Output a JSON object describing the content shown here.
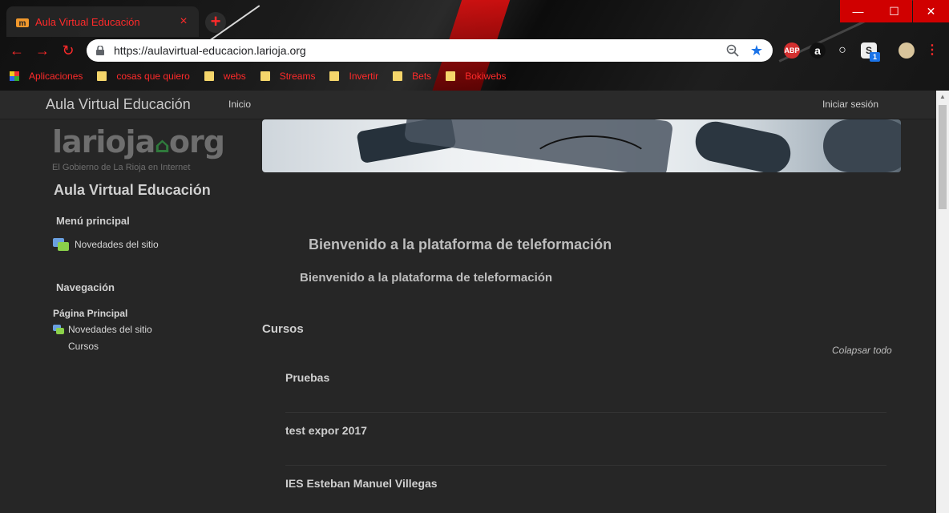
{
  "browser": {
    "tab_title": "Aula Virtual Educación",
    "tab_close": "×",
    "new_tab": "+",
    "url": "https://aulavirtual-educacion.larioja.org",
    "window": {
      "minimize": "—",
      "maximize": "☐",
      "close": "✕"
    },
    "nav": {
      "back": "←",
      "forward": "→",
      "reload": "↻"
    },
    "extensions": [
      "ABP",
      "a",
      "○",
      "S"
    ],
    "ext_badge": "1",
    "menu": "⋮",
    "star": "★",
    "bookmarks": [
      {
        "label": "Aplicaciones",
        "icon": "apps-grid-icon"
      },
      {
        "label": "cosas que quiero",
        "icon": "folder-icon"
      },
      {
        "label": "webs",
        "icon": "folder-icon"
      },
      {
        "label": "Streams",
        "icon": "folder-icon"
      },
      {
        "label": "Invertir",
        "icon": "folder-icon"
      },
      {
        "label": "Bets",
        "icon": "folder-icon"
      },
      {
        "label": "Bokiwebs",
        "icon": "folder-icon"
      }
    ],
    "accent_color": "#ff2a2a"
  },
  "site": {
    "brand": "Aula Virtual Educación",
    "nav_home": "Inicio",
    "login": "Iniciar sesión",
    "logo_main": "larioja",
    "logo_org": "org",
    "logo_sub": "El Gobierno de La Rioja en Internet"
  },
  "sidebar": {
    "title": "Aula Virtual Educación",
    "main_menu_heading": "Menú principal",
    "main_menu_item": "Novedades del sitio",
    "navigation_heading": "Navegación",
    "nav_home": "Página Principal",
    "nav_news": "Novedades del sitio",
    "nav_courses": "Cursos"
  },
  "main": {
    "welcome_heading": "Bienvenido a la plataforma de teleformación",
    "welcome_sub": "Bienvenido a la plataforma de teleformación",
    "courses_heading": "Cursos",
    "collapse_all": "Colapsar todo",
    "courses": [
      "Pruebas",
      "test expor 2017",
      "IES Esteban Manuel Villegas"
    ]
  }
}
